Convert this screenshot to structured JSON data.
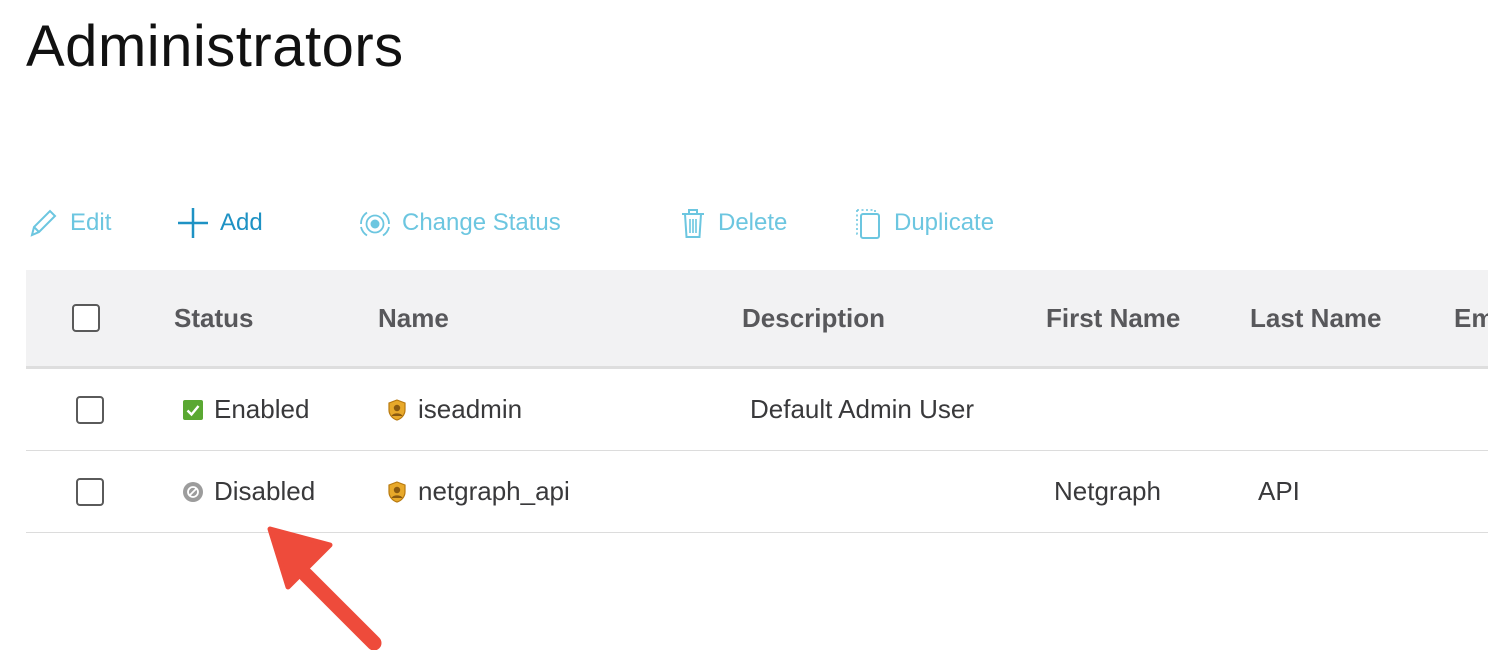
{
  "page": {
    "title": "Administrators"
  },
  "toolbar": {
    "edit_label": "Edit",
    "add_label": "Add",
    "change_status_label": "Change Status",
    "delete_label": "Delete",
    "duplicate_label": "Duplicate"
  },
  "table": {
    "columns": [
      "Status",
      "Name",
      "Description",
      "First Name",
      "Last Name",
      "Em"
    ],
    "rows": [
      {
        "status": "Enabled",
        "name": "iseadmin",
        "description": "Default Admin User",
        "first_name": "",
        "last_name": ""
      },
      {
        "status": "Disabled",
        "name": "netgraph_api",
        "description": "",
        "first_name": "Netgraph",
        "last_name": "API"
      }
    ]
  },
  "colors": {
    "toolbar_text": "#6cc6e0",
    "toolbar_active": "#1e92c4",
    "enabled_green": "#5aa832",
    "disabled_gray": "#9c9c9c",
    "arrow_red": "#ee4b3b"
  }
}
